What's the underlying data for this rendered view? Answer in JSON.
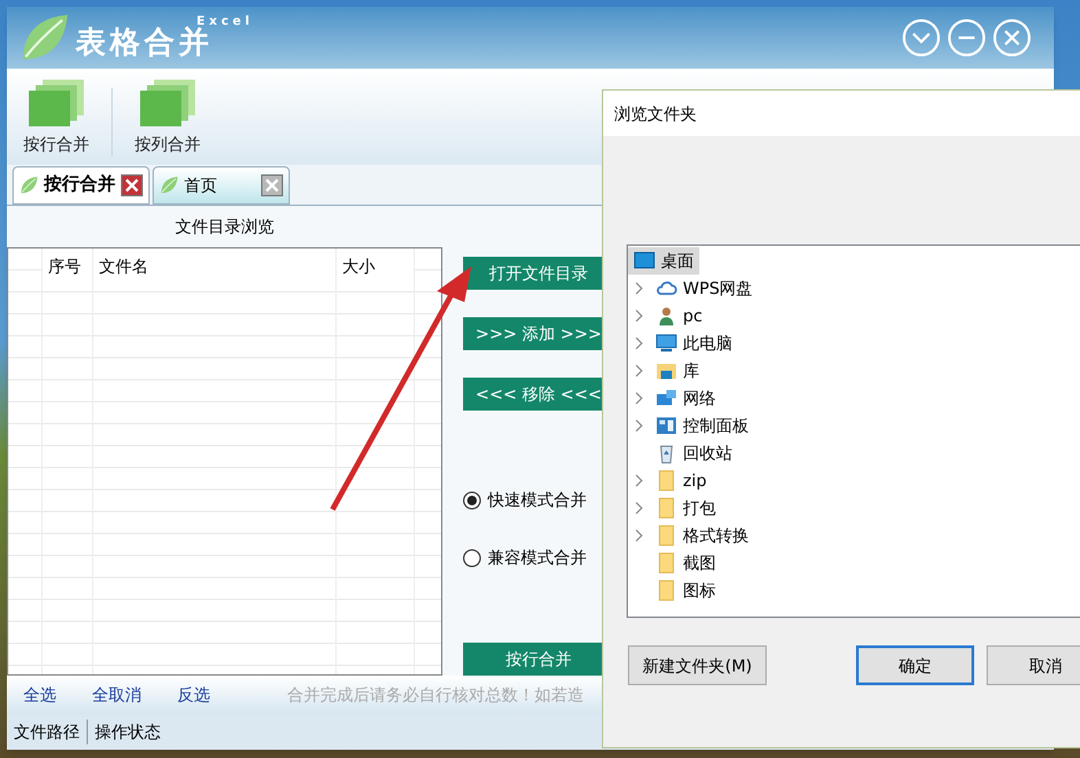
{
  "app": {
    "logo_sub": "Excel",
    "logo_title": "表格合并"
  },
  "toolbar": [
    {
      "label": "按行合并"
    },
    {
      "label": "按列合并"
    }
  ],
  "tabs": [
    {
      "label": "按行合并",
      "selected": true
    },
    {
      "label": "首页",
      "selected": false
    }
  ],
  "section_title": "文件目录浏览",
  "table": {
    "columns": [
      "序号",
      "文件名",
      "大小"
    ]
  },
  "actions": [
    {
      "label": "打开文件目录",
      "kind": "button"
    },
    {
      "label": ">>> 添加 >>>",
      "kind": "button"
    },
    {
      "label": "<<< 移除 <<<",
      "kind": "button"
    }
  ],
  "modes": [
    {
      "label": "快速模式合并",
      "selected": true
    },
    {
      "label": "兼容模式合并",
      "selected": false
    }
  ],
  "merge_button": "按行合并",
  "links": [
    "全选",
    "全取消",
    "反选"
  ],
  "notice": "合并完成后请务必自行核对总数！如若造",
  "status_bar": [
    "文件路径",
    "操作状态"
  ],
  "dialog": {
    "title": "浏览文件夹",
    "tree": [
      {
        "label": "桌面",
        "kind": "desktop",
        "expandable": false,
        "selected": true
      },
      {
        "label": "WPS网盘",
        "kind": "cloud",
        "expandable": true,
        "selected": false
      },
      {
        "label": "pc",
        "kind": "user",
        "expandable": true,
        "selected": false
      },
      {
        "label": "此电脑",
        "kind": "computer",
        "expandable": true,
        "selected": false
      },
      {
        "label": "库",
        "kind": "library",
        "expandable": true,
        "selected": false
      },
      {
        "label": "网络",
        "kind": "network",
        "expandable": true,
        "selected": false
      },
      {
        "label": "控制面板",
        "kind": "control",
        "expandable": true,
        "selected": false
      },
      {
        "label": "回收站",
        "kind": "recycle",
        "expandable": false,
        "selected": false
      },
      {
        "label": "zip",
        "kind": "folder",
        "expandable": true,
        "selected": false
      },
      {
        "label": "打包",
        "kind": "folder",
        "expandable": true,
        "selected": false
      },
      {
        "label": "格式转换",
        "kind": "folder",
        "expandable": true,
        "selected": false
      },
      {
        "label": "截图",
        "kind": "folder",
        "expandable": false,
        "selected": false
      },
      {
        "label": "图标",
        "kind": "folder",
        "expandable": false,
        "selected": false
      }
    ],
    "buttons": [
      {
        "label": "新建文件夹(M)",
        "kind": "normal"
      },
      {
        "label": "确定",
        "kind": "default"
      },
      {
        "label": "取消",
        "kind": "normal"
      }
    ]
  }
}
